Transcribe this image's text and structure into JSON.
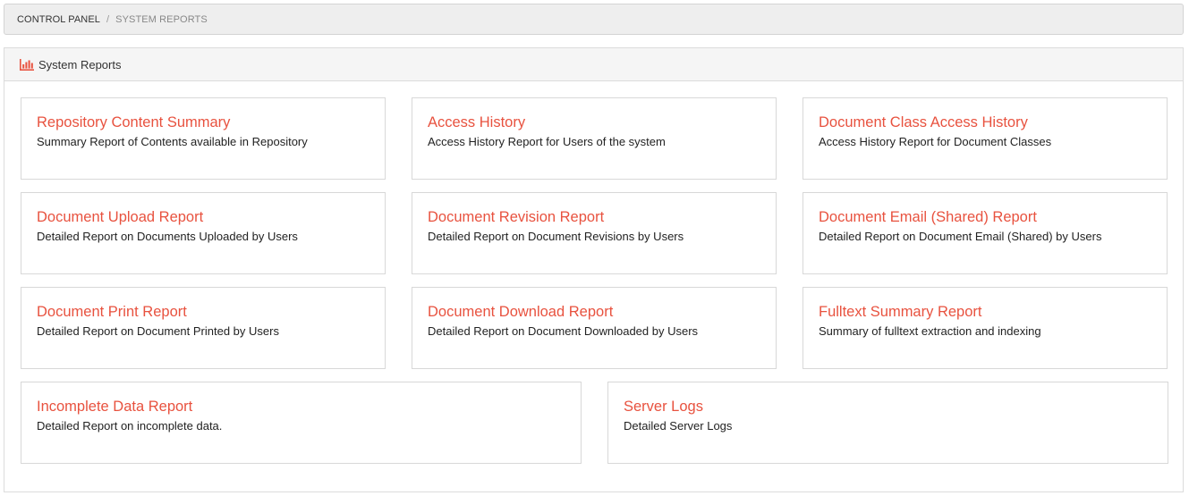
{
  "breadcrumb": {
    "home": "CONTROL PANEL",
    "separator": "/",
    "current": "SYSTEM REPORTS"
  },
  "panel": {
    "title": "System Reports",
    "icon": "bar-chart-icon",
    "accent_color": "#e8523f"
  },
  "reports": [
    {
      "title": "Repository Content Summary",
      "description": "Summary Report of Contents available in Repository"
    },
    {
      "title": "Access History",
      "description": "Access History Report for Users of the system"
    },
    {
      "title": "Document Class Access History",
      "description": "Access History Report for Document Classes"
    },
    {
      "title": "Document Upload Report",
      "description": "Detailed Report on Documents Uploaded by Users"
    },
    {
      "title": "Document Revision Report",
      "description": "Detailed Report on Document Revisions by Users"
    },
    {
      "title": "Document Email (Shared) Report",
      "description": "Detailed Report on Document Email (Shared) by Users"
    },
    {
      "title": "Document Print Report",
      "description": "Detailed Report on Document Printed by Users"
    },
    {
      "title": "Document Download Report",
      "description": "Detailed Report on Document Downloaded by Users"
    },
    {
      "title": "Fulltext Summary Report",
      "description": "Summary of fulltext extraction and indexing"
    },
    {
      "title": "Incomplete Data Report",
      "description": "Detailed Report on incomplete data."
    },
    {
      "title": "Server Logs",
      "description": "Detailed Server Logs"
    }
  ]
}
